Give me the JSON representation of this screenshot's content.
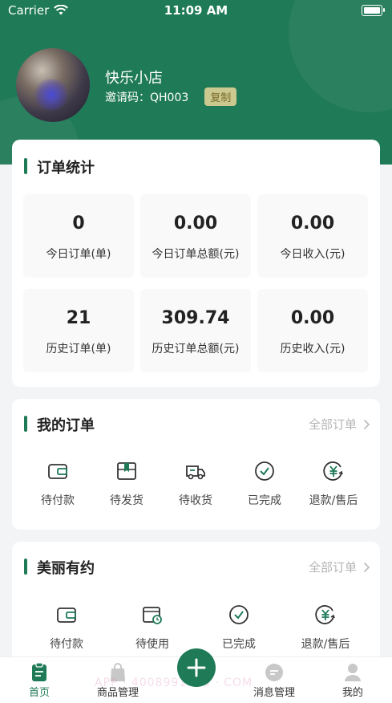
{
  "status_bar": {
    "carrier": "Carrier",
    "time": "11:09 AM"
  },
  "profile": {
    "store_name": "快乐小店",
    "invite_label": "邀请码：QH003",
    "copy_label": "复制"
  },
  "order_stats": {
    "title": "订单统计",
    "items": [
      {
        "value": "0",
        "label": "今日订单(单)"
      },
      {
        "value": "0.00",
        "label": "今日订单总额(元)"
      },
      {
        "value": "0.00",
        "label": "今日收入(元)"
      },
      {
        "value": "21",
        "label": "历史订单(单)"
      },
      {
        "value": "309.74",
        "label": "历史订单总额(元)"
      },
      {
        "value": "0.00",
        "label": "历史收入(元)"
      }
    ]
  },
  "my_orders": {
    "title": "我的订单",
    "more_label": "全部订单",
    "items": [
      {
        "label": "待付款",
        "icon": "wallet-icon"
      },
      {
        "label": "待发货",
        "icon": "box-icon"
      },
      {
        "label": "待收货",
        "icon": "truck-icon"
      },
      {
        "label": "已完成",
        "icon": "check-circle-icon"
      },
      {
        "label": "退款/售后",
        "icon": "yen-refund-icon"
      }
    ]
  },
  "beauty": {
    "title": "美丽有约",
    "more_label": "全部订单",
    "items": [
      {
        "label": "待付款",
        "icon": "wallet-icon"
      },
      {
        "label": "待使用",
        "icon": "calendar-clock-icon"
      },
      {
        "label": "已完成",
        "icon": "check-circle-icon"
      },
      {
        "label": "退款/售后",
        "icon": "yen-refund-icon"
      }
    ]
  },
  "tabbar": {
    "items": [
      {
        "label": "首页",
        "icon": "clipboard-icon",
        "active": true
      },
      {
        "label": "商品管理",
        "icon": "bag-icon",
        "active": false
      },
      {
        "label": "消息管理",
        "icon": "message-icon",
        "active": false
      },
      {
        "label": "我的",
        "icon": "user-icon",
        "active": false
      }
    ],
    "add_icon": "plus-icon"
  },
  "watermark": "APP · 4008991800 · COM",
  "colors": {
    "primary": "#1f7a57",
    "background": "#f3f4f6"
  }
}
